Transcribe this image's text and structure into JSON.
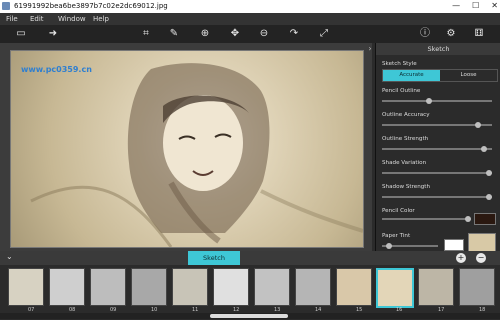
{
  "window": {
    "title": "61991992bea6be3897b7c02e2dc69012.jpg",
    "controls": [
      "—",
      "☐",
      "✕"
    ]
  },
  "menu": {
    "items": [
      "File",
      "Edit",
      "Window",
      "Help"
    ]
  },
  "watermark": {
    "text": "www.pc0359.cn",
    "color": "#2f7fd0"
  },
  "toolbar": {
    "left_icons": [
      "image-icon",
      "share-icon",
      "crop-icon",
      "brush-icon",
      "zoom-in-icon",
      "move-icon",
      "zoom-out-icon",
      "redo-icon",
      "fit-icon"
    ],
    "right_icons": [
      "info-icon",
      "settings-icon",
      "dice-icon"
    ]
  },
  "panel": {
    "title": "Sketch",
    "style_label": "Sketch Style",
    "style_options": [
      "Accurate",
      "Loose"
    ],
    "style_selected": "Accurate",
    "sliders": [
      {
        "label": "Pencil Outline",
        "value": 0.4
      },
      {
        "label": "Outline Accuracy",
        "value": 0.85
      },
      {
        "label": "Outline Strength",
        "value": 0.9
      },
      {
        "label": "Shade Variation",
        "value": 0.95
      },
      {
        "label": "Shadow Strength",
        "value": 0.95
      },
      {
        "label": "Pencil Color",
        "value": 0.8
      },
      {
        "label": "Paper Tint",
        "value": 0.1
      }
    ],
    "pencil_color": "#2a1810",
    "paper_color": "#ffffff",
    "paper_texture_color": "#d8c9a6"
  },
  "bottom": {
    "tab_label": "Sketch",
    "add_label": "+",
    "remove_label": "−"
  },
  "filmstrip": {
    "numbers": [
      "07",
      "08",
      "09",
      "10",
      "11",
      "12",
      "13",
      "14",
      "15",
      "16",
      "17",
      "18"
    ],
    "selected_index": 9
  },
  "colors": {
    "accent": "#3ec7d6"
  }
}
